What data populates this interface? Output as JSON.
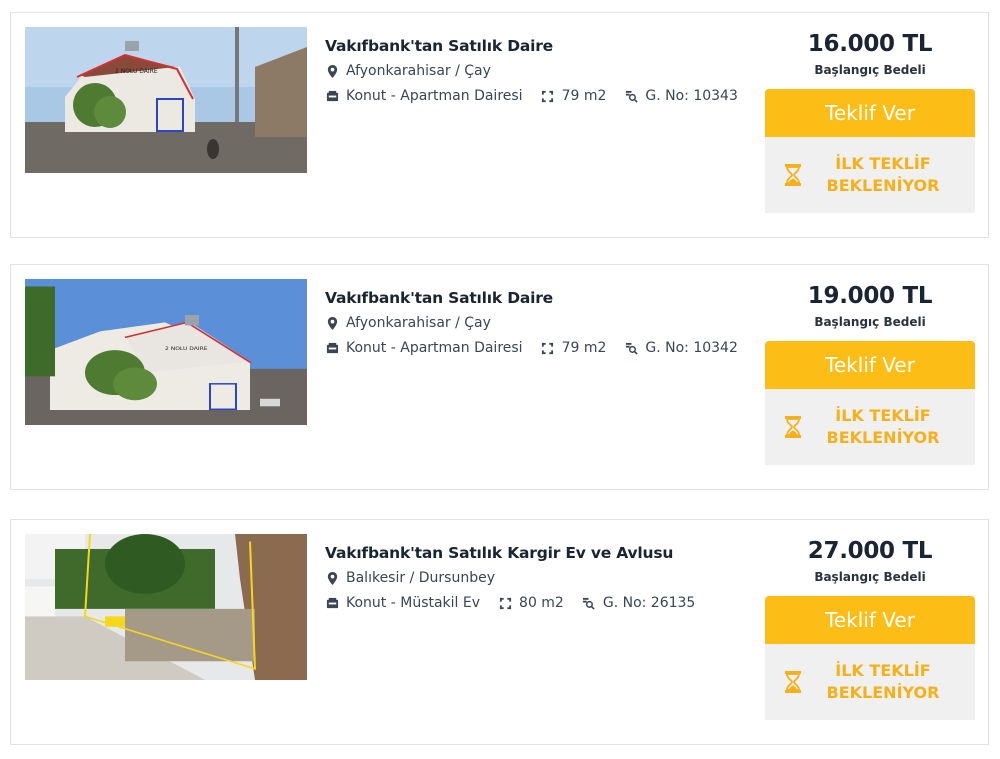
{
  "listings": [
    {
      "title": "Vakıfbank'tan Satılık Daire",
      "location": "Afyonkarahisar / Çay",
      "type": "Konut - Apartman Dairesi",
      "area": "79 m2",
      "gno": "G. No: 10343",
      "price": "16.000 TL",
      "price_label": "Başlangıç Bedeli",
      "bid_label": "Teklif Ver",
      "status_line1": "İLK TEKLİF",
      "status_line2": "BEKLENİYOR",
      "photo_label": "2 NOLU DAIRE"
    },
    {
      "title": "Vakıfbank'tan Satılık Daire",
      "location": "Afyonkarahisar / Çay",
      "type": "Konut - Apartman Dairesi",
      "area": "79 m2",
      "gno": "G. No: 10342",
      "price": "19.000 TL",
      "price_label": "Başlangıç Bedeli",
      "bid_label": "Teklif Ver",
      "status_line1": "İLK TEKLİF",
      "status_line2": "BEKLENİYOR",
      "photo_label": "2 NOLU DAIRE"
    },
    {
      "title": "Vakıfbank'tan Satılık Kargir Ev ve Avlusu",
      "location": "Balıkesir / Dursunbey",
      "type": "Konut - Müstakil Ev",
      "area": "80 m2",
      "gno": "G. No: 26135",
      "price": "27.000 TL",
      "price_label": "Başlangıç Bedeli",
      "bid_label": "Teklif Ver",
      "status_line1": "İLK TEKLİF",
      "status_line2": "BEKLENİYOR"
    }
  ],
  "colors": {
    "accent": "#fbbd16",
    "status_text": "#f5b01a",
    "status_bg": "#f0f0f0",
    "title": "#1b2431"
  },
  "icons": {
    "location": "map-pin-icon",
    "type": "building-icon",
    "area": "area-icon",
    "gno": "search-doc-icon",
    "status": "hourglass-icon"
  }
}
